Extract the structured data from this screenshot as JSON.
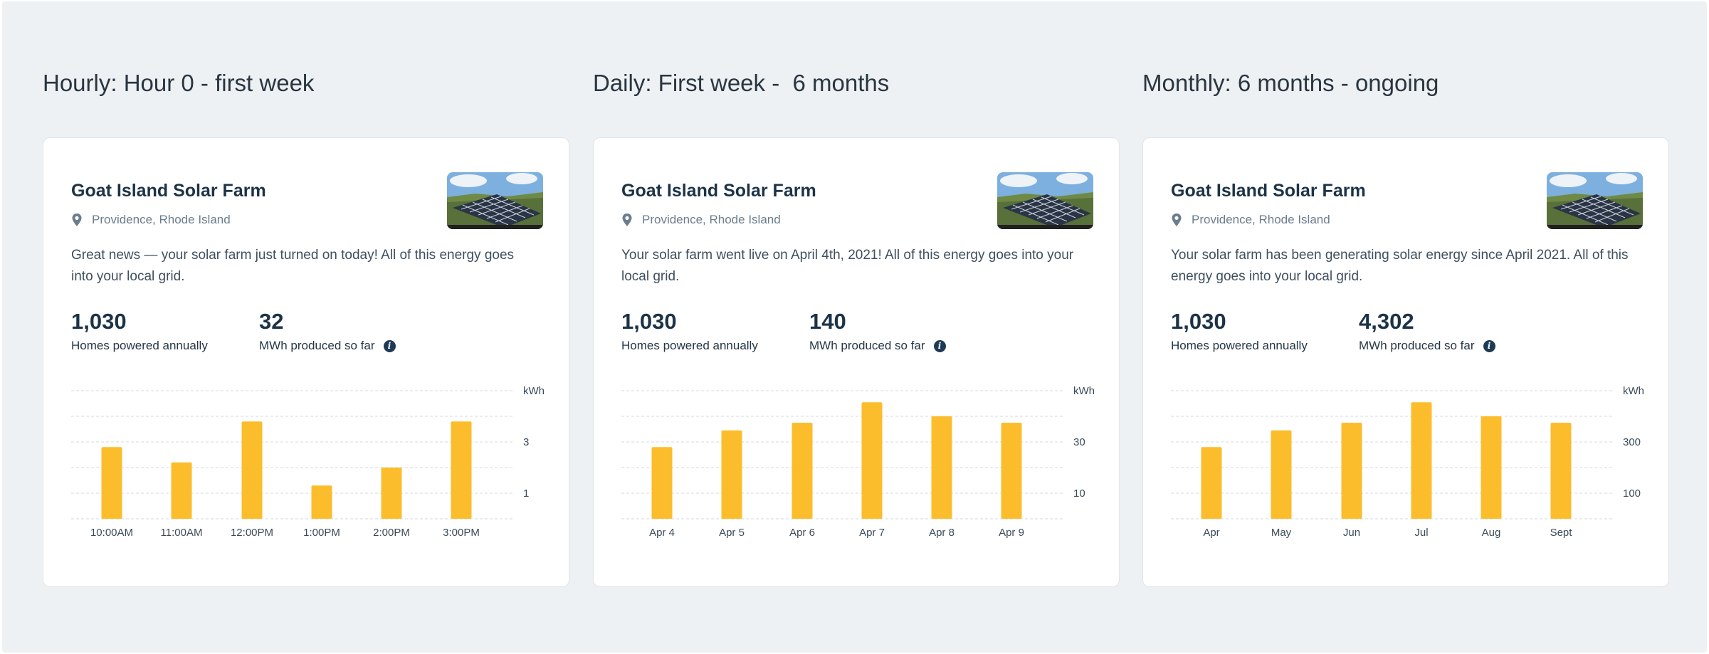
{
  "colors": {
    "bar": "#fcbd2d",
    "page_bg": "#edf1f4",
    "card_bg": "#ffffff",
    "heading": "#1c3347",
    "info_icon": "#1f3a55"
  },
  "icons": {
    "location": "map-pin-icon",
    "info": "info-icon",
    "thumbnail": "solar-panel-photo"
  },
  "columns": [
    {
      "heading": "Hourly: Hour 0 - first week",
      "card": {
        "farm_name": "Goat Island Solar Farm",
        "location": "Providence, Rhode Island",
        "description": "Great news — your solar farm just turned on today! All of this energy goes into your local grid.",
        "stats": [
          {
            "value": "1,030",
            "label": "Homes powered annually"
          },
          {
            "value": "32",
            "label": "MWh produced so far"
          }
        ]
      }
    },
    {
      "heading": "Daily: First week -  6 months",
      "card": {
        "farm_name": "Goat Island Solar Farm",
        "location": "Providence, Rhode Island",
        "description": "Your solar farm went live on April 4th, 2021! All of this energy goes into your local grid.",
        "stats": [
          {
            "value": "1,030",
            "label": "Homes powered annually"
          },
          {
            "value": "140",
            "label": "MWh produced so far"
          }
        ]
      }
    },
    {
      "heading": "Monthly: 6 months - ongoing",
      "card": {
        "farm_name": "Goat Island Solar Farm",
        "location": "Providence, Rhode Island",
        "description": "Your solar farm has been generating solar energy since April 2021. All of this energy goes into your local grid.",
        "stats": [
          {
            "value": "1,030",
            "label": "Homes powered annually"
          },
          {
            "value": "4,302",
            "label": "MWh produced so far"
          }
        ]
      }
    }
  ],
  "chart_data": [
    {
      "type": "bar",
      "title": "",
      "xlabel": "",
      "ylabel": "kWh",
      "categories": [
        "10:00AM",
        "11:00AM",
        "12:00PM",
        "1:00PM",
        "2:00PM",
        "3:00PM"
      ],
      "values": [
        2.8,
        2.2,
        3.8,
        1.3,
        2.0,
        3.8
      ],
      "yticks": [
        1,
        3
      ],
      "ylim": [
        0,
        5
      ],
      "grid": true
    },
    {
      "type": "bar",
      "title": "",
      "xlabel": "",
      "ylabel": "kWh",
      "categories": [
        "Apr 4",
        "Apr 5",
        "Apr 6",
        "Apr 7",
        "Apr 8",
        "Apr 9"
      ],
      "values": [
        28,
        34.5,
        37.5,
        45.5,
        40,
        37.5
      ],
      "yticks": [
        10,
        30
      ],
      "ylim": [
        0,
        50
      ],
      "grid": true
    },
    {
      "type": "bar",
      "title": "",
      "xlabel": "",
      "ylabel": "kWh",
      "categories": [
        "Apr",
        "May",
        "Jun",
        "Jul",
        "Aug",
        "Sept"
      ],
      "values": [
        280,
        345,
        375,
        455,
        400,
        375
      ],
      "yticks": [
        100,
        300
      ],
      "ylim": [
        0,
        500
      ],
      "grid": true
    }
  ]
}
